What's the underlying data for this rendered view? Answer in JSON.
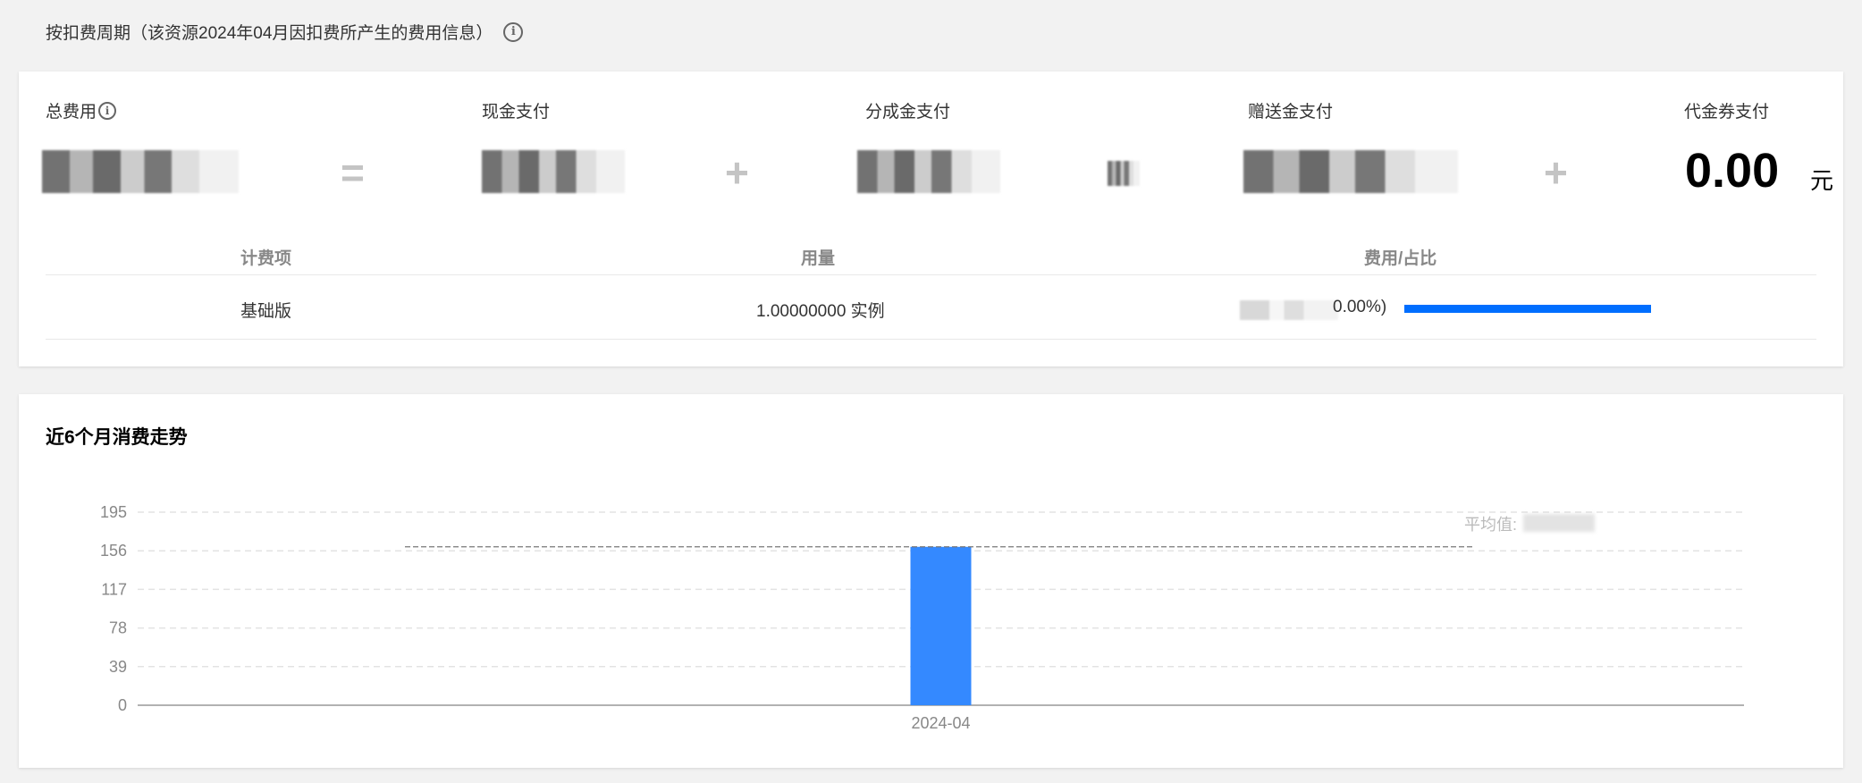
{
  "period": {
    "title": "按扣费周期（该资源2024年04月因扣费所产生的费用信息）",
    "info_icon": "info-circle-icon"
  },
  "payments": {
    "total_label": "总费用",
    "cash_label": "现金支付",
    "share_label": "分成金支付",
    "gift_label": "赠送金支付",
    "voucher_label": "代金券支付",
    "voucher_value": "0.00",
    "voucher_unit": "元",
    "equals": "=",
    "plus": "+"
  },
  "table": {
    "headers": [
      "计费项",
      "用量",
      "费用/占比"
    ],
    "rows": [
      {
        "item": "基础版",
        "usage": "1.00000000 实例",
        "cost_suffix": "0.00%)",
        "share": 1.0
      }
    ],
    "bar_color": "#006eff"
  },
  "trend": {
    "title": "近6个月消费走势",
    "avg_label": "平均值:"
  },
  "chart_data": {
    "type": "bar",
    "categories": [
      "2024-04"
    ],
    "values": [
      160
    ],
    "yticks": [
      0,
      39,
      78,
      117,
      156,
      195
    ],
    "ylim": [
      0,
      195
    ],
    "average_line": 160,
    "bar_color": "#3489ff",
    "grid": true
  }
}
